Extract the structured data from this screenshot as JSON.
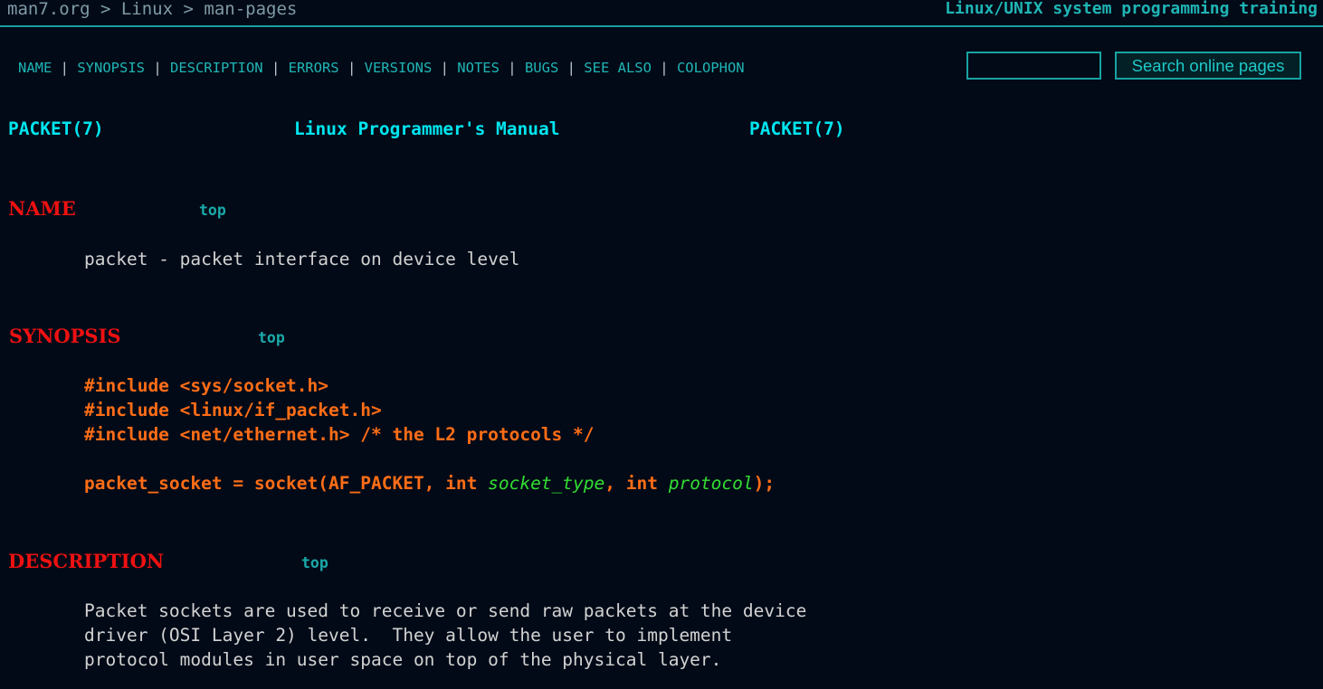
{
  "breadcrumb": {
    "site": "man7.org",
    "sep1": " > ",
    "section": "Linux",
    "sep2": " > ",
    "page": "man-pages"
  },
  "training_link": "Linux/UNIX system programming training",
  "section_nav": [
    {
      "label": "NAME"
    },
    {
      "label": "SYNOPSIS"
    },
    {
      "label": "DESCRIPTION"
    },
    {
      "label": "ERRORS"
    },
    {
      "label": "VERSIONS"
    },
    {
      "label": "NOTES"
    },
    {
      "label": "BUGS"
    },
    {
      "label": "SEE ALSO"
    },
    {
      "label": "COLOPHON"
    }
  ],
  "nav_separator": " | ",
  "search": {
    "value": "",
    "button_label": "Search online pages"
  },
  "header": {
    "left": "PACKET(7)",
    "center": "Linux Programmer's Manual",
    "right": "PACKET(7)"
  },
  "sections": {
    "name": {
      "title": "NAME",
      "top_label": "top",
      "text": "packet - packet interface on device level"
    },
    "synopsis": {
      "title": "SYNOPSIS",
      "top_label": "top",
      "include1": "#include <sys/socket.h>",
      "include2": "#include <linux/if_packet.h>",
      "include3": "#include <net/ethernet.h> /* the L2 protocols */",
      "call_prefix": "packet_socket = socket(AF_PACKET, int ",
      "arg1": "socket_type",
      "call_mid": ", int ",
      "arg2": "protocol",
      "call_suffix": ");"
    },
    "description": {
      "title": "DESCRIPTION",
      "top_label": "top",
      "line1": "Packet sockets are used to receive or send raw packets at the device",
      "line2": "driver (OSI Layer 2) level.  They allow the user to implement",
      "line3": "protocol modules in user space on top of the physical layer."
    }
  },
  "colors": {
    "background": "#020a17",
    "accent": "#17a3a3",
    "section_heading": "#ee1111",
    "synopsis": "#ff6d17",
    "argument": "#33dd33",
    "header": "#00e5ee"
  }
}
